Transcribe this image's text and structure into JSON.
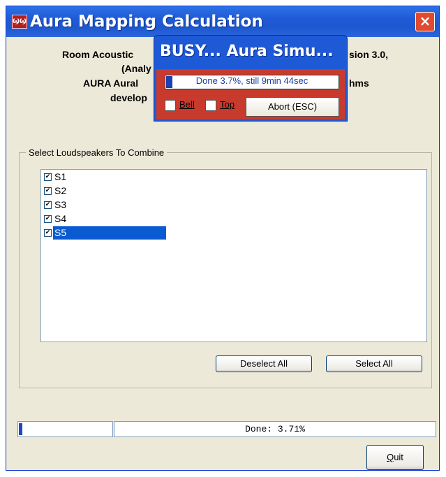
{
  "window": {
    "title": "Aura Mapping Calculation",
    "icon": "app-icon",
    "close_icon": "×",
    "icon_glyph": "ϢϢ"
  },
  "header": {
    "line1_left": "Room Acoustic",
    "line1_right": "sion 3.0,",
    "line2": "(Analy",
    "line3_left": "AURA Aural",
    "line3_right": "hms",
    "line4": "develop"
  },
  "group": {
    "label": "Select Loudspeakers To Combine",
    "items": [
      {
        "label": "S1",
        "checked": true,
        "selected": false
      },
      {
        "label": "S2",
        "checked": true,
        "selected": false
      },
      {
        "label": "S3",
        "checked": true,
        "selected": false
      },
      {
        "label": "S4",
        "checked": true,
        "selected": false
      },
      {
        "label": "S5",
        "checked": true,
        "selected": true
      }
    ],
    "deselect_label": "Deselect All",
    "select_label": "Select All"
  },
  "status": {
    "progress_fraction": 0.037,
    "text": "Done: 3.71%"
  },
  "quit_label": "Quit",
  "busy": {
    "title": "BUSY... Aura Simu...",
    "progress_text": "Done  3.7%, still 9min 44sec",
    "progress_fraction": 0.037,
    "bell_label": "Bell",
    "top_label": "Top",
    "abort_label": "Abort (ESC)"
  },
  "colors": {
    "titlebar": "#1f5bd6",
    "selection": "#0a5ad1",
    "busy_body": "#c83a2c"
  }
}
